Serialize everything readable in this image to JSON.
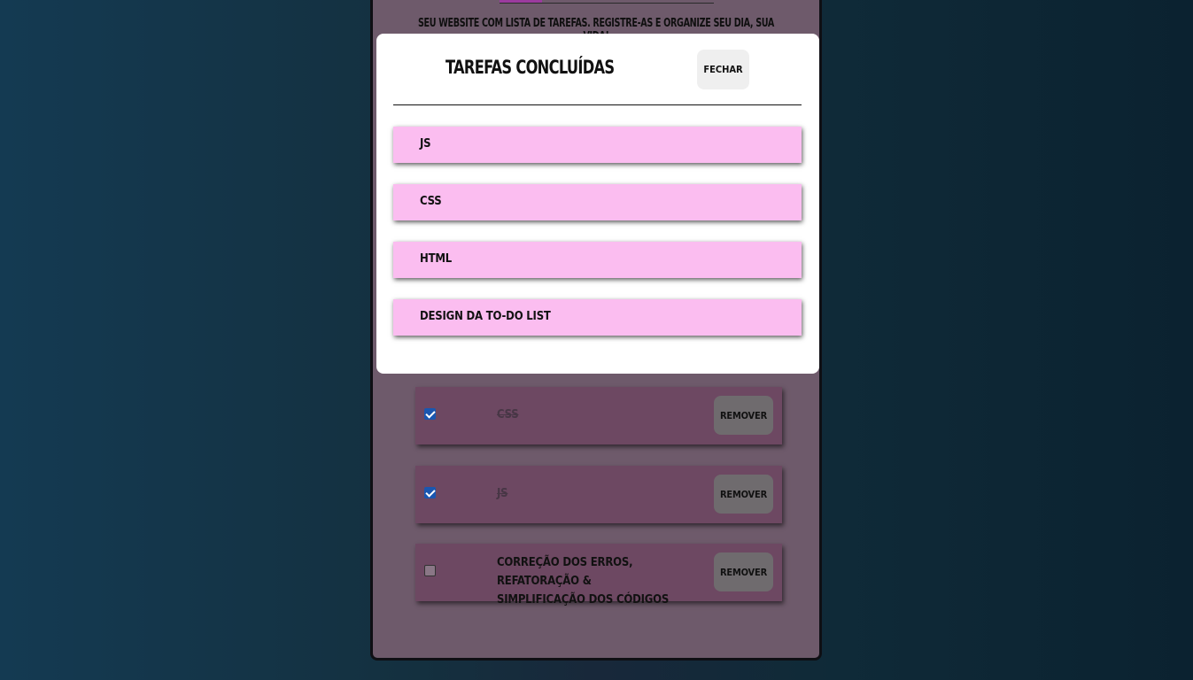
{
  "app": {
    "tagline": "Seu website com lista de tarefas. Registre-as e organize seu dia, sua vida!",
    "tasks": [
      {
        "text": "CSS",
        "done": true,
        "remove_label": "Remover"
      },
      {
        "text": "JS",
        "done": true,
        "remove_label": "Remover"
      },
      {
        "text": "Correção dos erros, refatoração & simplificação dos códigos",
        "done": false,
        "remove_label": "Remover"
      }
    ]
  },
  "modal": {
    "title": "Tarefas concluídas",
    "close_label": "Fechar",
    "items": [
      {
        "text": "JS"
      },
      {
        "text": "CSS"
      },
      {
        "text": "HTML"
      },
      {
        "text": "Design da To-Do List"
      }
    ]
  },
  "colors": {
    "background": "#143a52",
    "card": "#6e5a6b",
    "task": "#6d4862",
    "modal_item": "#fbbdf0",
    "checkbox_checked": "#1a57b0",
    "progress_fill": "#9b3b9e"
  }
}
